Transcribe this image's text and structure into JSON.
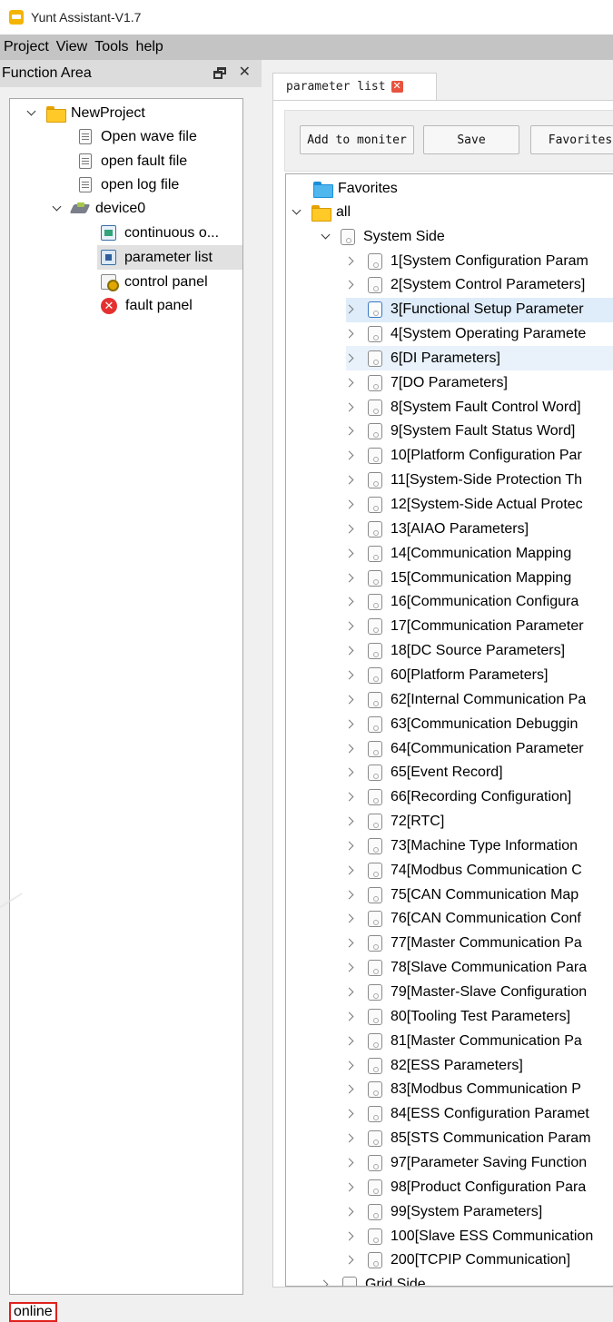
{
  "app": {
    "title": "Yunt Assistant-V1.7"
  },
  "menu": [
    "Project",
    "View",
    "Tools",
    "help"
  ],
  "function_area": {
    "title": "Function Area",
    "tree": {
      "project": "NewProject",
      "files": [
        "Open wave file",
        "open fault file",
        "open log file"
      ],
      "device": "device0",
      "device_items": [
        "continuous o...",
        "parameter list",
        "control panel",
        "fault panel"
      ]
    }
  },
  "tab": {
    "label": "parameter list"
  },
  "toolbar": {
    "add_to_monitor": "Add to moniter",
    "save": "Save",
    "favorites": "Favorites"
  },
  "param_tree": {
    "favorites": "Favorites",
    "all": "all",
    "system_side": "System Side",
    "groups": [
      "1[System Configuration Param",
      "2[System Control Parameters]",
      "3[Functional Setup Parameter",
      "4[System Operating Paramete",
      "6[DI Parameters]",
      "7[DO Parameters]",
      "8[System Fault Control Word]",
      "9[System Fault Status Word]",
      "10[Platform Configuration Par",
      "11[System-Side Protection Th",
      "12[System-Side Actual Protec",
      "13[AIAO Parameters]",
      "14[Communication Mapping",
      "15[Communication Mapping",
      "16[Communication Configura",
      "17[Communication Parameter",
      "18[DC Source Parameters]",
      "60[Platform Parameters]",
      "62[Internal Communication Pa",
      "63[Communication Debuggin",
      "64[Communication Parameter",
      "65[Event Record]",
      "66[Recording Configuration]",
      "72[RTC]",
      "73[Machine Type Information",
      "74[Modbus Communication C",
      "75[CAN Communication Map",
      "76[CAN Communication Conf",
      "77[Master Communication Pa",
      "78[Slave Communication Para",
      "79[Master-Slave Configuration",
      "80[Tooling Test Parameters]",
      "81[Master Communication Pa",
      "82[ESS Parameters]",
      "83[Modbus Communication P",
      "84[ESS Configuration Paramet",
      "85[STS Communication Param",
      "97[Parameter Saving Function",
      "98[Product Configuration Para",
      "99[System Parameters]",
      "100[Slave ESS Communication",
      "200[TCPIP Communication]"
    ],
    "grid_side": "Grid Side",
    "selected_index": 2,
    "hover_index": 4
  },
  "status": {
    "text": "online",
    "highlight_color": "#e0201c"
  }
}
